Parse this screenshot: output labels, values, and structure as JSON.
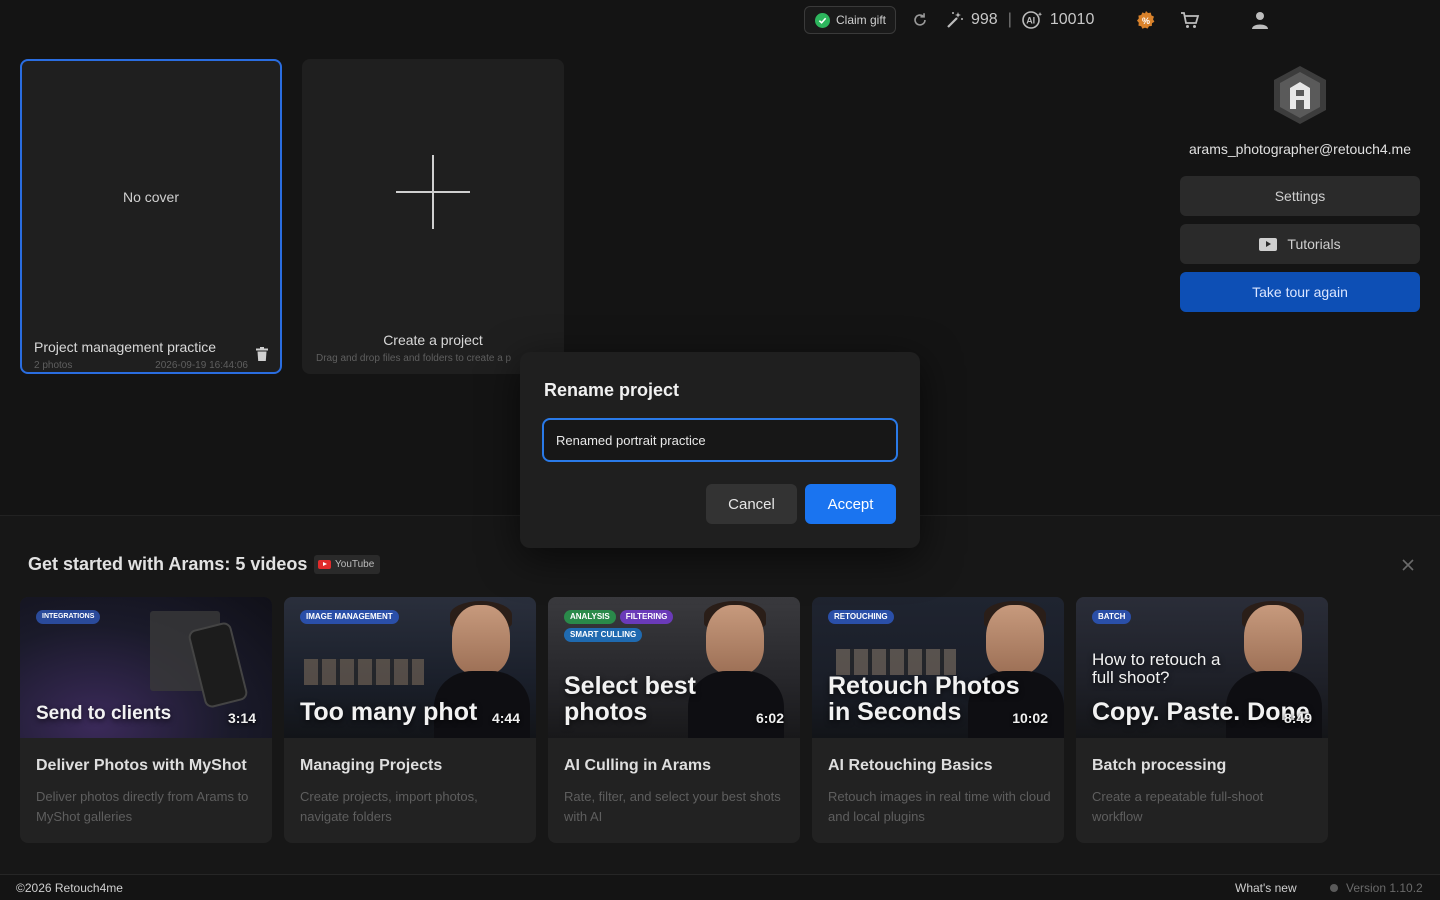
{
  "topbar": {
    "claim_gift": "Claim gift",
    "credits_magic": "998",
    "credits_separator": "|",
    "credits_ai": "10010"
  },
  "project": {
    "cover_text": "No cover",
    "title": "Project management practice",
    "photos": "2 photos",
    "date": "2026-09-19 16:44:06"
  },
  "create": {
    "title": "Create a project",
    "subtitle": "Drag and drop files and folders to create a p"
  },
  "profile": {
    "email": "arams_photographer@retouch4.me",
    "settings": "Settings",
    "tutorials": "Tutorials",
    "tour": "Take tour again"
  },
  "videos": {
    "heading": "Get started with Arams: 5 videos",
    "badge": "YouTube",
    "items": [
      {
        "tags": [
          "INTEGRATIONS"
        ],
        "big": "Send to clients",
        "duration": "3:14",
        "title": "Deliver Photos with MyShot",
        "desc": "Deliver photos directly from Arams to MyShot galleries"
      },
      {
        "tags": [
          "IMAGE MANAGEMENT"
        ],
        "big": "Too many phot",
        "duration": "4:44",
        "title": "Managing Projects",
        "desc": "Create projects, import photos, navigate folders"
      },
      {
        "tags": [
          "ANALYSIS",
          "FILTERING",
          "SMART CULLING"
        ],
        "big": "Select best photos",
        "duration": "6:02",
        "title": "AI Culling in Arams",
        "desc": "Rate, filter, and select your best shots with AI"
      },
      {
        "tags": [
          "RETOUCHING"
        ],
        "big": "Retouch Photos in Seconds",
        "duration": "10:02",
        "title": "AI Retouching Basics",
        "desc": "Retouch images in real time with cloud and local plugins"
      },
      {
        "tags": [
          "BATCH"
        ],
        "small": "How to retouch a full shoot?",
        "big": "Copy. Paste. Done",
        "duration": "8:49",
        "title": "Batch processing",
        "desc": "Create a repeatable full-shoot workflow"
      }
    ]
  },
  "footer": {
    "copyright": "©2026 Retouch4me",
    "whats_new": "What's new",
    "version": "Version 1.10.2"
  },
  "modal": {
    "title": "Rename project",
    "input_value": "Renamed portrait practice",
    "cancel": "Cancel",
    "accept": "Accept"
  },
  "colors": {
    "accent": "#1a74f0",
    "tour_button": "#0d4fb5",
    "selected_border": "#2a6de0",
    "gift_check": "#2db55d",
    "background": "#141414"
  }
}
